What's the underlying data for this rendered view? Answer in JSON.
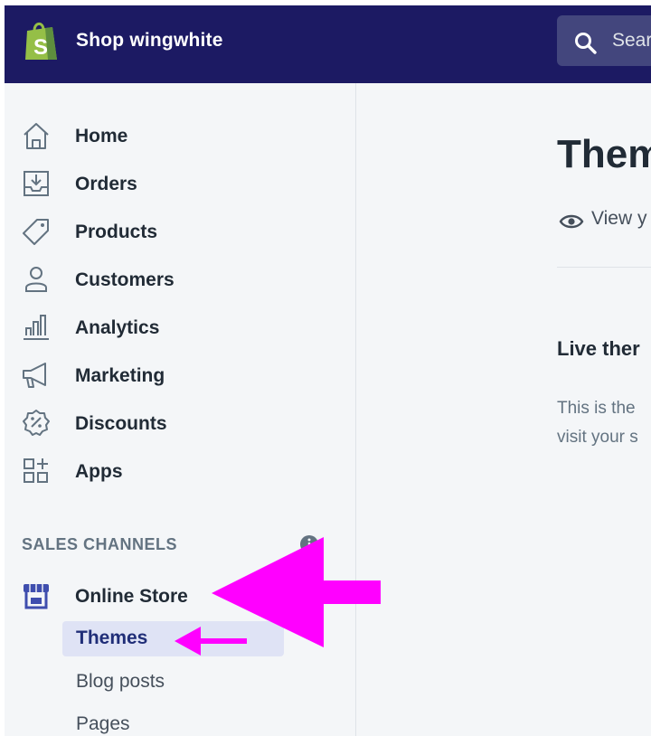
{
  "header": {
    "shop_name": "Shop wingwhite",
    "search_placeholder": "Sear"
  },
  "sidebar": {
    "items": [
      {
        "label": "Home",
        "icon": "home-icon"
      },
      {
        "label": "Orders",
        "icon": "orders-icon"
      },
      {
        "label": "Products",
        "icon": "tag-icon"
      },
      {
        "label": "Customers",
        "icon": "person-icon"
      },
      {
        "label": "Analytics",
        "icon": "bar-chart-icon"
      },
      {
        "label": "Marketing",
        "icon": "megaphone-icon"
      },
      {
        "label": "Discounts",
        "icon": "discount-badge-icon"
      },
      {
        "label": "Apps",
        "icon": "apps-grid-icon"
      }
    ],
    "section_title": "SALES CHANNELS",
    "channel": {
      "label": "Online Store",
      "icon": "store-icon"
    },
    "subitems": [
      {
        "label": "Themes",
        "active": true
      },
      {
        "label": "Blog posts"
      },
      {
        "label": "Pages"
      }
    ]
  },
  "main": {
    "title": "Them",
    "view_link": "View y",
    "live_theme_title": "Live ther",
    "live_theme_desc_line1": "This is the",
    "live_theme_desc_line2": "visit your s"
  },
  "colors": {
    "topbar": "#1c1a63",
    "logo_green": "#95bf47",
    "accent": "#202e78",
    "annotation_arrow": "#ff00ff"
  }
}
